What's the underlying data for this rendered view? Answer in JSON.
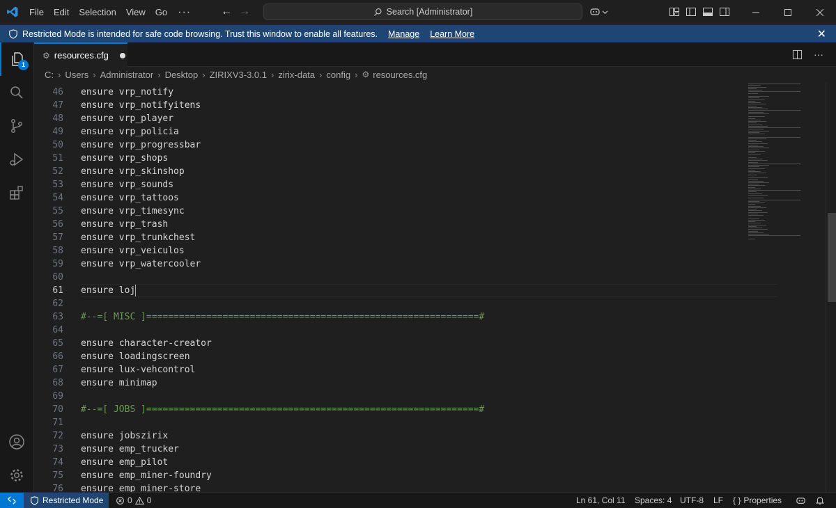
{
  "menu": [
    "File",
    "Edit",
    "Selection",
    "View",
    "Go"
  ],
  "menu_more": "···",
  "search": {
    "text": "Search [Administrator]"
  },
  "banner": {
    "message": "Restricted Mode is intended for safe code browsing. Trust this window to enable all features.",
    "manage": "Manage",
    "learn_more": "Learn More"
  },
  "explorer_badge": "1",
  "tab": {
    "title": "resources.cfg"
  },
  "breadcrumb": [
    "C:",
    "Users",
    "Administrator",
    "Desktop",
    "ZIRIXV3-3.0.1",
    "zirix-data",
    "config",
    "resources.cfg"
  ],
  "editor": {
    "active_line": "61",
    "lines": [
      {
        "n": "46",
        "text": "ensure vrp_notify",
        "type": "code"
      },
      {
        "n": "47",
        "text": "ensure vrp_notifyitens",
        "type": "code"
      },
      {
        "n": "48",
        "text": "ensure vrp_player",
        "type": "code"
      },
      {
        "n": "49",
        "text": "ensure vrp_policia",
        "type": "code"
      },
      {
        "n": "50",
        "text": "ensure vrp_progressbar",
        "type": "code"
      },
      {
        "n": "51",
        "text": "ensure vrp_shops",
        "type": "code"
      },
      {
        "n": "52",
        "text": "ensure vrp_skinshop",
        "type": "code"
      },
      {
        "n": "53",
        "text": "ensure vrp_sounds",
        "type": "code"
      },
      {
        "n": "54",
        "text": "ensure vrp_tattoos",
        "type": "code"
      },
      {
        "n": "55",
        "text": "ensure vrp_timesync",
        "type": "code"
      },
      {
        "n": "56",
        "text": "ensure vrp_trash",
        "type": "code"
      },
      {
        "n": "57",
        "text": "ensure vrp_trunkchest",
        "type": "code"
      },
      {
        "n": "58",
        "text": "ensure vrp_veiculos",
        "type": "code"
      },
      {
        "n": "59",
        "text": "ensure vrp_watercooler",
        "type": "code"
      },
      {
        "n": "60",
        "text": "",
        "type": "code"
      },
      {
        "n": "61",
        "text": "ensure loj",
        "type": "code"
      },
      {
        "n": "62",
        "text": "",
        "type": "code"
      },
      {
        "n": "63",
        "text": "#--=[ MISC ]=============================================================#",
        "type": "comment"
      },
      {
        "n": "64",
        "text": "",
        "type": "code"
      },
      {
        "n": "65",
        "text": "ensure character-creator",
        "type": "code"
      },
      {
        "n": "66",
        "text": "ensure loadingscreen",
        "type": "code"
      },
      {
        "n": "67",
        "text": "ensure lux-vehcontrol",
        "type": "code"
      },
      {
        "n": "68",
        "text": "ensure minimap",
        "type": "code"
      },
      {
        "n": "69",
        "text": "",
        "type": "code"
      },
      {
        "n": "70",
        "text": "#--=[ JOBS ]=============================================================#",
        "type": "comment"
      },
      {
        "n": "71",
        "text": "",
        "type": "code"
      },
      {
        "n": "72",
        "text": "ensure jobszirix",
        "type": "code"
      },
      {
        "n": "73",
        "text": "ensure emp_trucker",
        "type": "code"
      },
      {
        "n": "74",
        "text": "ensure emp_pilot",
        "type": "code"
      },
      {
        "n": "75",
        "text": "ensure emp_miner-foundry",
        "type": "code"
      },
      {
        "n": "76",
        "text": "ensure emp_miner-store",
        "type": "code"
      }
    ]
  },
  "status": {
    "restricted": "Restricted Mode",
    "errors": "0",
    "warnings": "0",
    "position": "Ln 61, Col 11",
    "spaces": "Spaces: 4",
    "encoding": "UTF-8",
    "eol": "LF",
    "language": "Properties"
  },
  "colors": {
    "accent": "#0078d4",
    "banner": "#1f4672",
    "comment": "#6a9955"
  }
}
